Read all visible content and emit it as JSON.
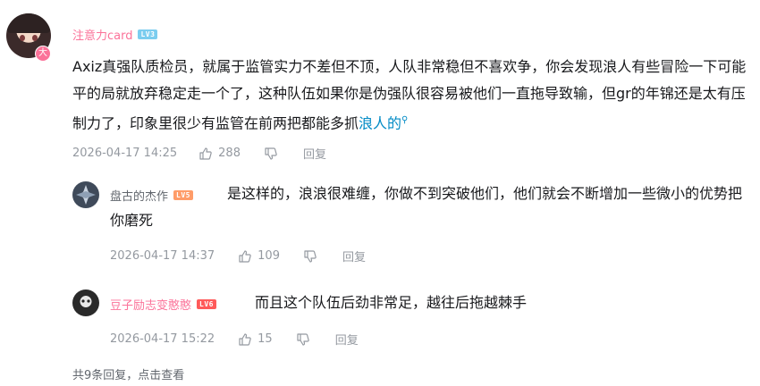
{
  "comment": {
    "username": "注意力card",
    "level": "LV3",
    "avatar_badge": "大",
    "text": "Axiz真强队质检员，就属于监管实力不差但不顶，人队非常稳但不喜欢争，你会发现浪人有些冒险一下可能平的局就放弃稳定走一个了，这种队伍如果你是伪强队很容易被他们一直拖导致输，但gr的年锦还是太有压制力了，印象里很少有监管在前两把都能多抓",
    "link_text": "浪人的",
    "time": "2026-04-17 14:25",
    "likes": "288",
    "reply_label": "回复"
  },
  "replies": [
    {
      "username": "盘古的杰作",
      "level": "LV5",
      "text": "是这样的，浪浪很难缠，你做不到突破他们，他们就会不断增加一些微小的优势把你磨死",
      "time": "2026-04-17 14:37",
      "likes": "109",
      "reply_label": "回复"
    },
    {
      "username": "豆子励志变憨憨",
      "level": "LV6",
      "text": "而且这个队伍后劲非常足，越往后拖越棘手",
      "time": "2026-04-17 15:22",
      "likes": "15",
      "reply_label": "回复"
    }
  ],
  "footer": {
    "summary": "共9条回复，点击查看"
  },
  "icons": [
    "thumb-up-icon",
    "thumb-down-icon",
    "search-icon"
  ],
  "colors": {
    "username_pink": "#fb7299",
    "link": "#008ac5",
    "meta": "#9499a0",
    "lv3": "#7bcdef",
    "lv5": "#ff9c68",
    "lv6": "#ff5a5a"
  }
}
